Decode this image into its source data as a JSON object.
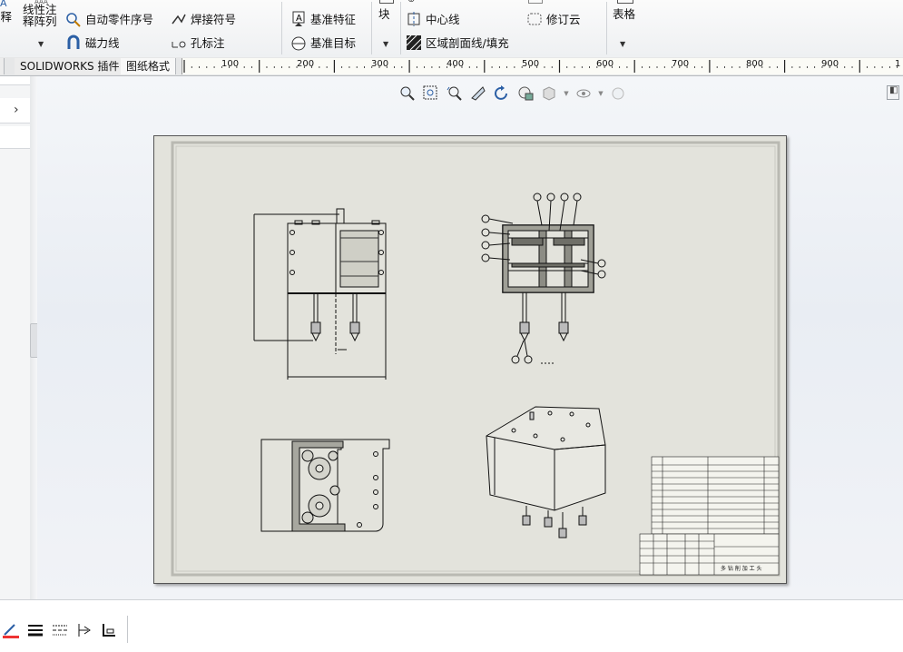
{
  "ribbon": {
    "annotation_partial": "注释",
    "linear_note_pattern": "线性注释阵列",
    "auto_balloon": "自动零件序号",
    "magnetic_line": "磁力线",
    "weld_symbol": "焊接符号",
    "hole_callout": "孔标注",
    "datum_feature": "基准特征",
    "datum_target": "基准目标",
    "block": "块",
    "centerline": "中心线",
    "area_hatch_fill": "区域剖面线/填充",
    "revision_cloud": "修订云",
    "table": "表格"
  },
  "tabs": [
    {
      "label": "SOLIDWORKS 插件"
    },
    {
      "label": "图纸格式"
    }
  ],
  "ruler": {
    "labels": [
      "100",
      "200",
      "300",
      "400",
      "500",
      "600",
      "700",
      "800",
      "900",
      "1"
    ]
  },
  "title_block": {
    "title": "多 钻 削 加 工 头"
  },
  "colors": {
    "sheet": "#e3e3dc",
    "accent": "#2b5fa5"
  }
}
